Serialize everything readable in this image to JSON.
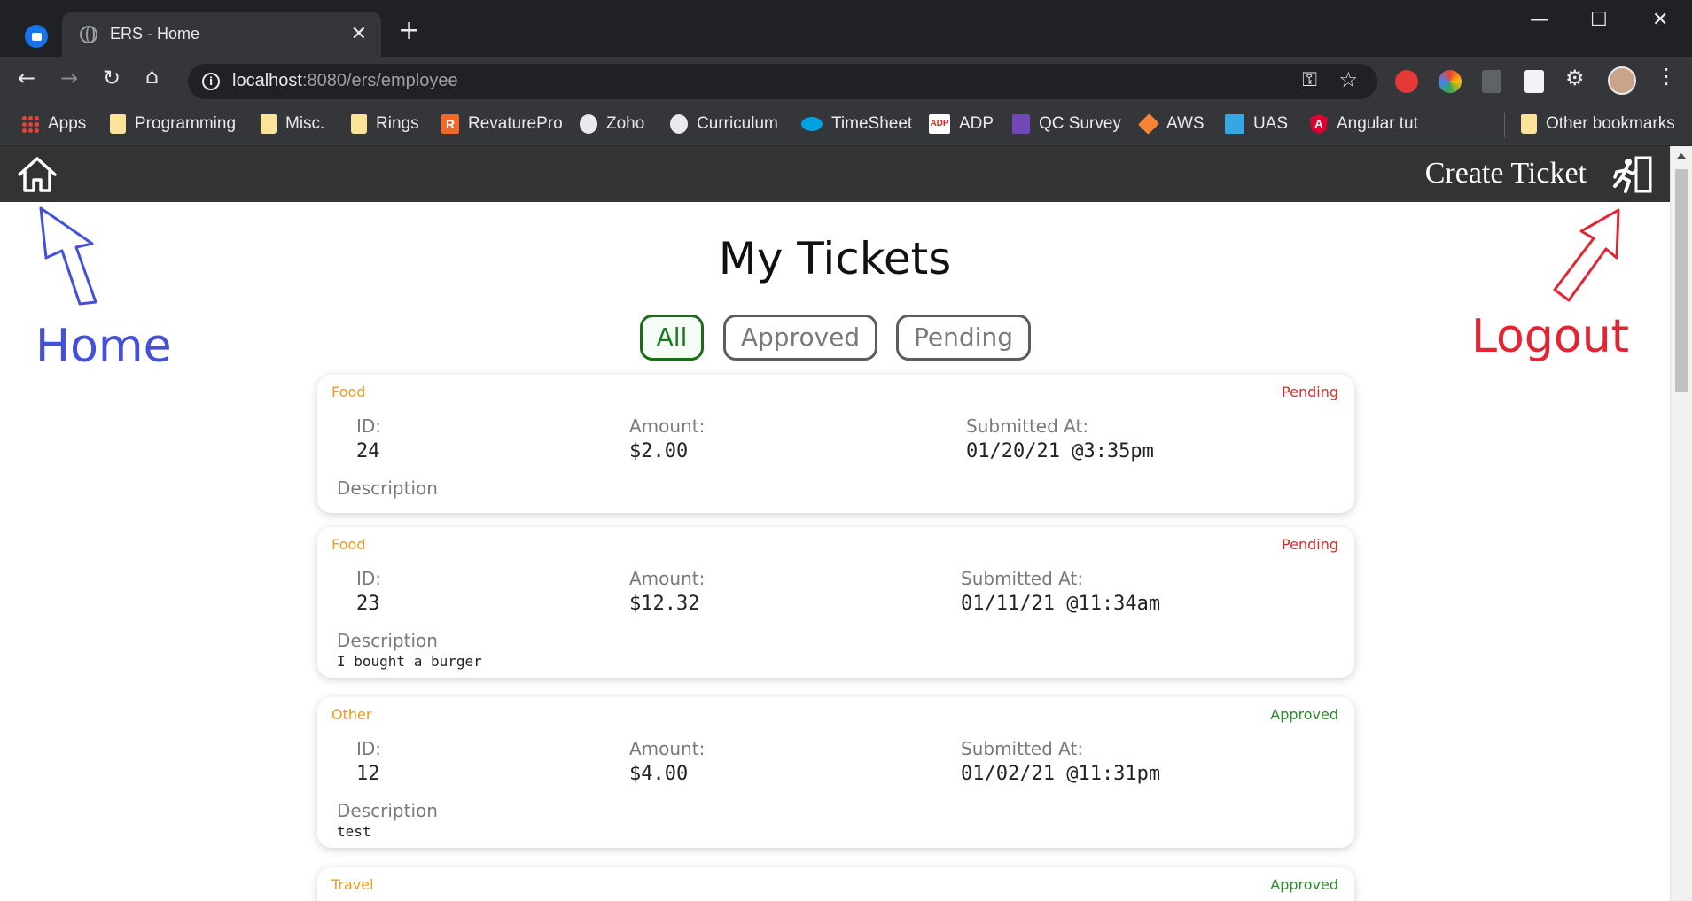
{
  "browser": {
    "tab_title": "ERS - Home",
    "tab_close": "✕",
    "new_tab": "+",
    "window_controls": [
      "—",
      "☐",
      "✕"
    ],
    "url_host": "localhost",
    "url_path": ":8080/ers/employee",
    "info_glyph": "i",
    "bookmarks": [
      {
        "label": "Apps",
        "icon": "apps-grid-icon"
      },
      {
        "label": "Programming",
        "icon": "folder-icon"
      },
      {
        "label": "Misc.",
        "icon": "folder-icon"
      },
      {
        "label": "Rings",
        "icon": "folder-icon"
      },
      {
        "label": "RevaturePro",
        "icon": "revaturepro-icon"
      },
      {
        "label": "Zoho",
        "icon": "zoho-icon"
      },
      {
        "label": "Curriculum",
        "icon": "github-icon"
      },
      {
        "label": "TimeSheet",
        "icon": "salesforce-icon"
      },
      {
        "label": "ADP",
        "icon": "adp-icon"
      },
      {
        "label": "QC Survey",
        "icon": "forms-icon"
      },
      {
        "label": "AWS",
        "icon": "aws-icon"
      },
      {
        "label": "UAS",
        "icon": "uas-icon"
      },
      {
        "label": "Angular tut",
        "icon": "angular-icon"
      }
    ],
    "other_bookmarks": "Other bookmarks",
    "revature_glyph": "R",
    "angular_glyph": "A",
    "adp_glyph": "ADP"
  },
  "app": {
    "nav": {
      "create_ticket": "Create Ticket"
    },
    "annotations": {
      "home": "Home",
      "logout": "Logout"
    },
    "heading": "My Tickets",
    "filters": [
      {
        "label": "All",
        "active": true
      },
      {
        "label": "Approved",
        "active": false
      },
      {
        "label": "Pending",
        "active": false
      }
    ],
    "field_labels": {
      "id": "ID:",
      "amount": "Amount:",
      "submitted": "Submitted At:",
      "description": "Description"
    },
    "tickets": [
      {
        "category": "Food",
        "status": "Pending",
        "id": "24",
        "amount": "$2.00",
        "submitted": "01/20/21 @3:35pm",
        "description": ""
      },
      {
        "category": "Food",
        "status": "Pending",
        "id": "23",
        "amount": "$12.32",
        "submitted": "01/11/21 @11:34am",
        "description": "I bought a burger"
      },
      {
        "category": "Other",
        "status": "Approved",
        "id": "12",
        "amount": "$4.00",
        "submitted": "01/02/21 @11:31pm",
        "description": "test"
      },
      {
        "category": "Travel",
        "status": "Approved"
      }
    ]
  },
  "colors": {
    "nav_bg": "#333333",
    "category": "#ef9a1a",
    "pending": "#e02a2a",
    "approved": "#2c8a2c",
    "home_annotation": "#4450d8",
    "logout_annotation": "#e52433"
  }
}
